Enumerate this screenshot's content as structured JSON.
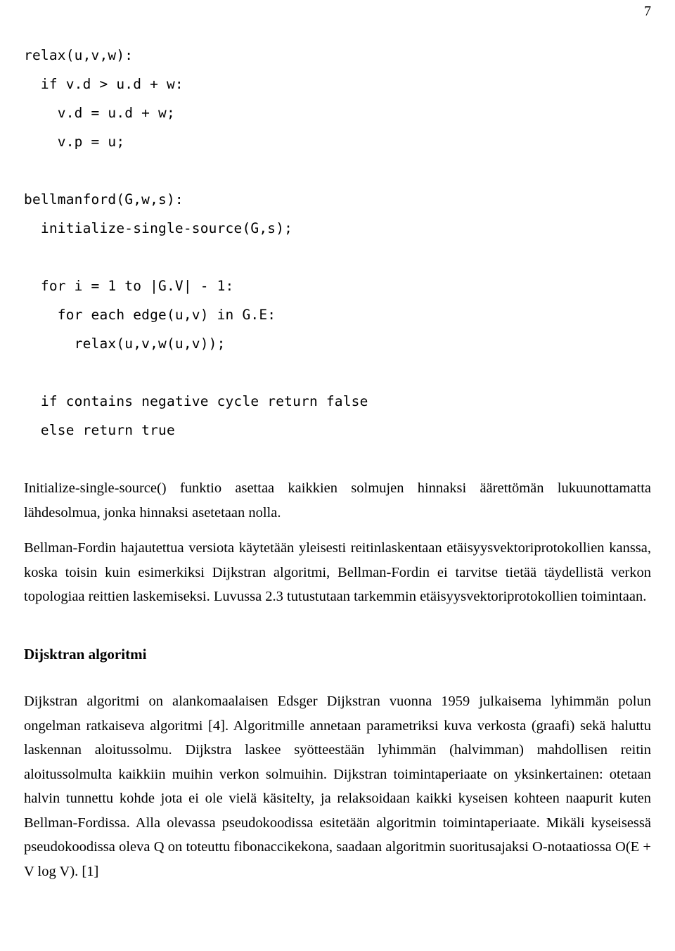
{
  "document": {
    "page_number": "7",
    "code": {
      "lines": [
        "relax(u,v,w):",
        "  if v.d > u.d + w:",
        "    v.d = u.d + w;",
        "    v.p = u;",
        "",
        "bellmanford(G,w,s):",
        "  initialize-single-source(G,s);",
        "",
        "  for i = 1 to |G.V| - 1:",
        "    for each edge(u,v) in G.E:",
        "      relax(u,v,w(u,v));",
        "",
        "  if contains negative cycle return false",
        "  else return true"
      ]
    },
    "paragraphs": [
      "Initialize-single-source() funktio asettaa kaikkien solmujen hinnaksi äärettömän lukuunottamatta lähdesolmua, jonka hinnaksi asetetaan nolla.",
      "Bellman-Fordin hajautettua versiota käytetään yleisesti reitinlaskentaan etäisyysvektoriprotokollien kanssa, koska toisin kuin esimerkiksi Dijkstran algoritmi, Bellman-Fordin ei tarvitse tietää täydellistä verkon topologiaa reittien laskemiseksi. Luvussa 2.3 tutustutaan tarkemmin etäisyysvektoriprotokollien toimintaan."
    ],
    "section_heading": "Dijsktran algoritmi",
    "section_paragraphs": [
      "Dijkstran algoritmi on alankomaalaisen Edsger Dijkstran vuonna 1959 julkaisema lyhimmän polun ongelman ratkaiseva algoritmi [4]. Algoritmille annetaan parametriksi kuva verkosta (graafi) sekä haluttu laskennan aloitussolmu. Dijkstra laskee syötteestään lyhimmän (halvimman) mahdollisen reitin aloitussolmulta kaikkiin muihin verkon solmuihin. Dijkstran toimintaperiaate on yksinkertainen: otetaan halvin tunnettu kohde jota ei ole vielä käsitelty, ja relaksoidaan kaikki kyseisen kohteen naapurit kuten Bellman-Fordissa. Alla olevassa pseudokoodissa esitetään algoritmin toimintaperiaate. Mikäli kyseisessä pseudokoodissa oleva Q on toteuttu fibonaccikekona, saadaan algoritmin suoritusajaksi O-notaatiossa O(E + V log V). [1]"
    ]
  }
}
